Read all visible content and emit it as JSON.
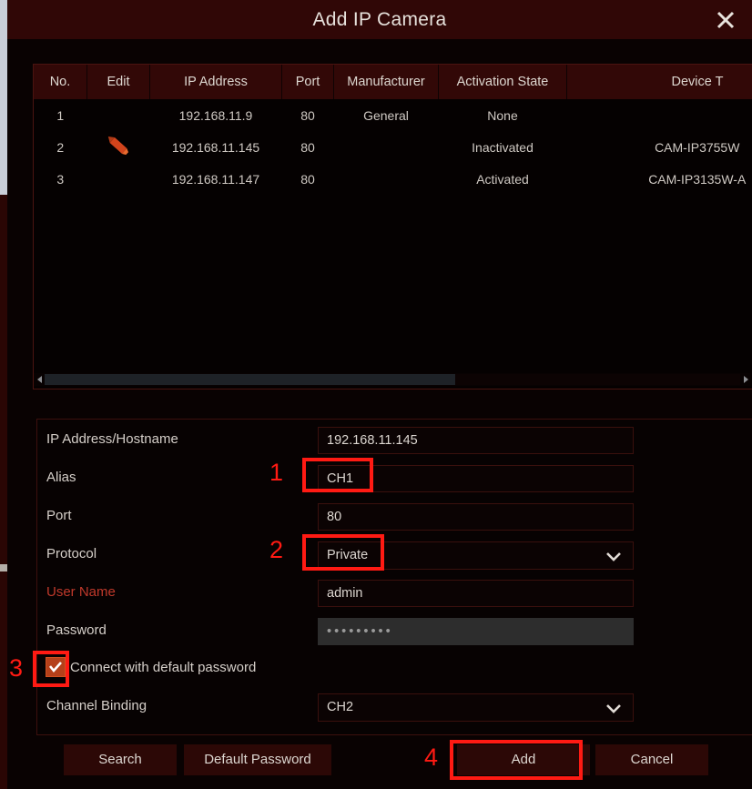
{
  "dialog": {
    "title": "Add IP Camera",
    "close_icon": "close-icon"
  },
  "table": {
    "columns": [
      "No.",
      "Edit",
      "IP Address",
      "Port",
      "Manufacturer",
      "Activation State",
      "Device T"
    ],
    "rows": [
      {
        "no": "1",
        "edit": "",
        "ip_address": "192.168.11.9",
        "port": "80",
        "manufacturer": "General",
        "activation_state": "None",
        "device_type": ""
      },
      {
        "no": "2",
        "edit": "edit-pencil-icon",
        "ip_address": "192.168.11.145",
        "port": "80",
        "manufacturer": "",
        "activation_state": "Inactivated",
        "device_type": "CAM-IP3755W"
      },
      {
        "no": "3",
        "edit": "",
        "ip_address": "192.168.11.147",
        "port": "80",
        "manufacturer": "",
        "activation_state": "Activated",
        "device_type": "CAM-IP3135W-A"
      }
    ],
    "scrollbar": {
      "left_arrow_icon": "triangle-left-icon",
      "right_arrow_icon": "triangle-right-icon",
      "thumb_percent": 59
    }
  },
  "form": {
    "fields": [
      {
        "label": "IP Address/Hostname",
        "value": "192.168.11.145",
        "type": "text"
      },
      {
        "label": "Alias",
        "value": "CH1",
        "type": "text"
      },
      {
        "label": "Port",
        "value": "80",
        "type": "text"
      },
      {
        "label": "Protocol",
        "value": "Private",
        "type": "select"
      },
      {
        "label": "User Name",
        "value": "admin",
        "type": "text"
      },
      {
        "label": "Password",
        "value": "•••••••••",
        "type": "password"
      },
      {
        "label": "Channel Binding",
        "value": "CH2",
        "type": "select"
      }
    ],
    "checkbox": {
      "label": "Connect with default password",
      "checked": true,
      "check_icon": "checkmark-icon"
    },
    "dropdown_icon": "chevron-down-icon"
  },
  "buttons": {
    "search": "Search",
    "default_password": "Default Password",
    "add": "Add",
    "cancel": "Cancel"
  },
  "annotations": {
    "one": "1",
    "two": "2",
    "three": "3",
    "four": "4"
  },
  "colors": {
    "annotation_red": "#ff1a13",
    "title_bar": "#300706",
    "table_header": "#320807",
    "checkbox_fill": "#b5401a",
    "required_label": "#c0392b",
    "pencil_icon": "#d2441c"
  }
}
